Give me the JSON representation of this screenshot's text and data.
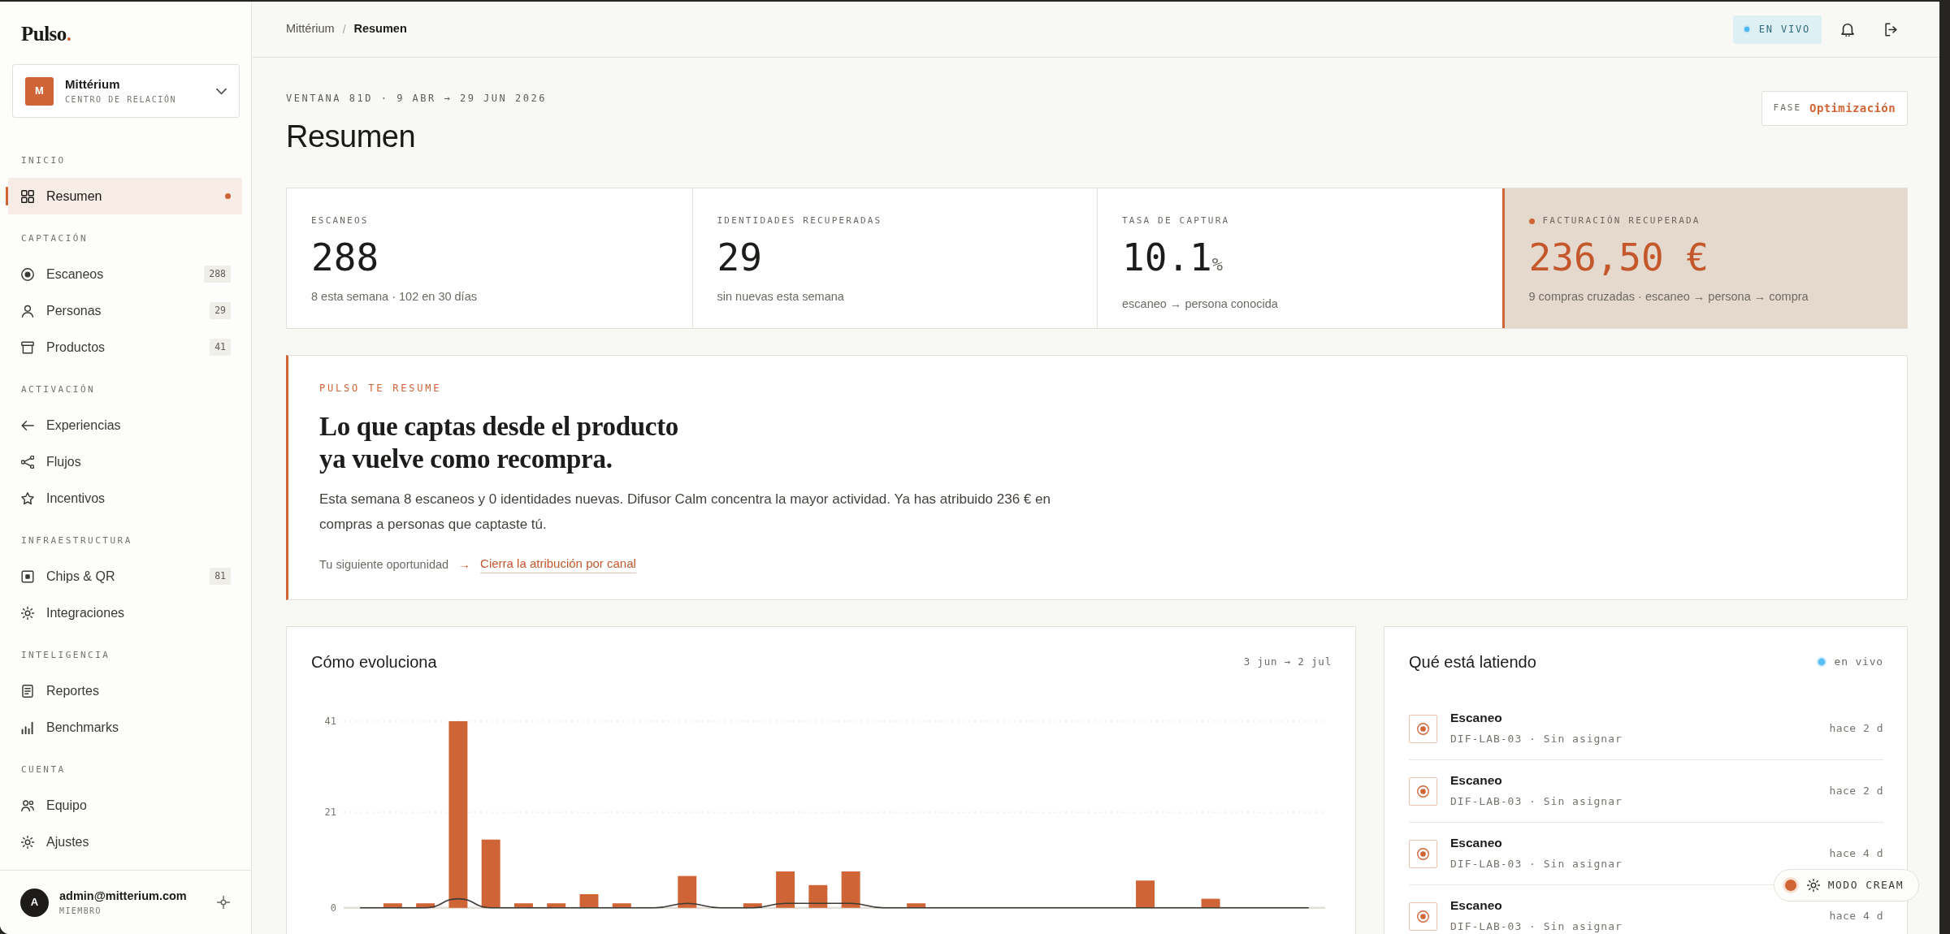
{
  "sidebar": {
    "logo": {
      "text": "Pulso",
      "mark": "."
    },
    "workspace": {
      "initial": "M",
      "name": "Mittérium",
      "subtitle": "CENTRO DE RELACIÓN"
    },
    "sections": [
      {
        "title": "INICIO",
        "items": [
          {
            "label": "Resumen",
            "selected": true
          }
        ]
      },
      {
        "title": "CAPTACIÓN",
        "items": [
          {
            "label": "Escaneos",
            "count": "288",
            "selected": false
          },
          {
            "label": "Personas",
            "count": "29",
            "selected": false
          },
          {
            "label": "Productos",
            "count": "41",
            "selected": false
          }
        ]
      },
      {
        "title": "ACTIVACIÓN",
        "items": [
          {
            "label": "Experiencias",
            "selected": false
          },
          {
            "label": "Flujos",
            "selected": false
          },
          {
            "label": "Incentivos",
            "selected": false
          }
        ]
      },
      {
        "title": "INFRAESTRUCTURA",
        "items": [
          {
            "label": "Chips & QR",
            "count": "81",
            "selected": false
          },
          {
            "label": "Integraciones",
            "selected": false
          }
        ]
      },
      {
        "title": "INTELIGENCIA",
        "items": [
          {
            "label": "Reportes",
            "selected": false
          },
          {
            "label": "Benchmarks",
            "selected": false
          }
        ]
      },
      {
        "title": "CUENTA",
        "items": [
          {
            "label": "Equipo",
            "selected": false
          },
          {
            "label": "Ajustes",
            "selected": false
          }
        ]
      }
    ],
    "user": {
      "initial": "A",
      "email": "admin@mitterium.com",
      "role": "MIEMBRO"
    }
  },
  "topbar": {
    "breadcrumb": [
      {
        "label": "Mittérium",
        "current": false
      },
      {
        "label": "Resumen",
        "current": true
      }
    ],
    "separator": "/",
    "live_badge": "EN VIVO"
  },
  "header": {
    "period": "VENTANA 81D · 9 ABR → 29 JUN 2026",
    "title": "Resumen",
    "phase": {
      "label": "FASE",
      "value": "Optimización"
    }
  },
  "stats": [
    {
      "label": "ESCANEOS",
      "value": "288",
      "note": "8 esta semana · 102 en 30 días",
      "highlighted": false
    },
    {
      "label": "IDENTIDADES RECUPERADAS",
      "value": "29",
      "note": "sin nuevas esta semana",
      "highlighted": false
    },
    {
      "label": "TASA DE CAPTURA",
      "value": "10.1",
      "unit": "%",
      "note": "escaneo → persona conocida",
      "highlighted": false
    },
    {
      "label": "FACTURACIÓN RECUPERADA",
      "value": "236,50 €",
      "note": "9 compras cruzadas · escaneo → persona → compra",
      "highlighted": true
    }
  ],
  "summary": {
    "eyebrow": "PULSO TE RESUME",
    "heading": "Lo que captas desde el producto\nya vuelve como recompra.",
    "text": "Esta semana 8 escaneos y 0 identidades nuevas. Difusor Calm concentra la mayor actividad. Ya has atribuido 236 € en compras a personas que captaste tú.",
    "next": {
      "label": "Tu siguiente oportunidad",
      "arrow": "→",
      "link": "Cierra la atribución por canal"
    }
  },
  "chart": {
    "title": "Cómo evoluciona",
    "range": "3 jun → 2 jul",
    "chart_data": {
      "type": "bar",
      "ylim": [
        0,
        41
      ],
      "yticks": [
        0,
        21,
        41
      ],
      "series": [
        {
          "type": "bar",
          "color": "#cf6537",
          "values": [
            0,
            1,
            1,
            41,
            15,
            1,
            1,
            3,
            1,
            0,
            7,
            0,
            1,
            8,
            5,
            8,
            0,
            1,
            0,
            0,
            0,
            0,
            0,
            0,
            6,
            0,
            2,
            0,
            0,
            0
          ]
        },
        {
          "type": "line",
          "color": "#3d3b37",
          "values": [
            0,
            0,
            0,
            2,
            0,
            0,
            0,
            0,
            0,
            0,
            1,
            0,
            0,
            1,
            1,
            1,
            0,
            0,
            0,
            0,
            0,
            0,
            0,
            0,
            0,
            0,
            0,
            0,
            0,
            0
          ]
        }
      ]
    }
  },
  "feed": {
    "title": "Qué está latiendo",
    "live": "en vivo",
    "items": [
      {
        "title": "Escaneo",
        "detail": "DIF-LAB-03 · Sin asignar",
        "time": "hace 2 d"
      },
      {
        "title": "Escaneo",
        "detail": "DIF-LAB-03 · Sin asignar",
        "time": "hace 2 d"
      },
      {
        "title": "Escaneo",
        "detail": "DIF-LAB-03 · Sin asignar",
        "time": "hace 4 d"
      },
      {
        "title": "Escaneo",
        "detail": "DIF-LAB-03 · Sin asignar",
        "time": "hace 4 d"
      }
    ]
  },
  "theme_toggle": {
    "label": "MODO CREAM"
  }
}
